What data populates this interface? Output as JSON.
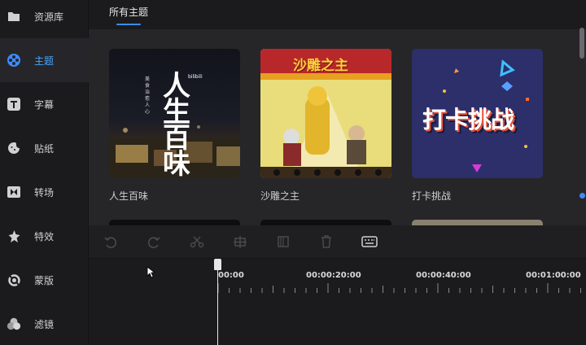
{
  "sidebar": {
    "items": [
      {
        "label": "资源库",
        "icon": "folder-icon"
      },
      {
        "label": "主题",
        "icon": "film-reel-icon",
        "active": true
      },
      {
        "label": "字幕",
        "icon": "text-t-icon"
      },
      {
        "label": "贴纸",
        "icon": "sticker-face-icon"
      },
      {
        "label": "转场",
        "icon": "transition-icon"
      },
      {
        "label": "特效",
        "icon": "star-effect-icon"
      },
      {
        "label": "蒙版",
        "icon": "mask-icon"
      },
      {
        "label": "滤镜",
        "icon": "filter-circles-icon"
      }
    ]
  },
  "tabs": {
    "all_themes": "所有主题"
  },
  "themes": [
    {
      "title": "人生百味",
      "thumb_text": "人生百味",
      "thumb_tag": "bilibili",
      "thumb_sub": "美食治愈人心"
    },
    {
      "title": "沙雕之主",
      "thumb_text": "沙雕之主"
    },
    {
      "title": "打卡挑战",
      "thumb_text": "打卡挑战"
    }
  ],
  "timeline": {
    "marks": [
      "00:00",
      "00:00:20:00",
      "00:00:40:00",
      "00:01:00:00"
    ]
  },
  "colors": {
    "accent": "#3d8bff",
    "active_label": "#4aa3ff"
  }
}
